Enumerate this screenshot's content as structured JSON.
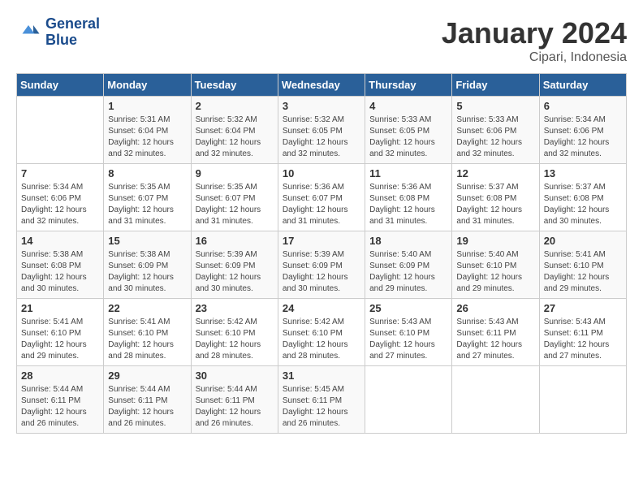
{
  "header": {
    "logo_line1": "General",
    "logo_line2": "Blue",
    "title": "January 2024",
    "subtitle": "Cipari, Indonesia"
  },
  "days_of_week": [
    "Sunday",
    "Monday",
    "Tuesday",
    "Wednesday",
    "Thursday",
    "Friday",
    "Saturday"
  ],
  "weeks": [
    [
      {
        "day": "",
        "sunrise": "",
        "sunset": "",
        "daylight": ""
      },
      {
        "day": "1",
        "sunrise": "Sunrise: 5:31 AM",
        "sunset": "Sunset: 6:04 PM",
        "daylight": "Daylight: 12 hours and 32 minutes."
      },
      {
        "day": "2",
        "sunrise": "Sunrise: 5:32 AM",
        "sunset": "Sunset: 6:04 PM",
        "daylight": "Daylight: 12 hours and 32 minutes."
      },
      {
        "day": "3",
        "sunrise": "Sunrise: 5:32 AM",
        "sunset": "Sunset: 6:05 PM",
        "daylight": "Daylight: 12 hours and 32 minutes."
      },
      {
        "day": "4",
        "sunrise": "Sunrise: 5:33 AM",
        "sunset": "Sunset: 6:05 PM",
        "daylight": "Daylight: 12 hours and 32 minutes."
      },
      {
        "day": "5",
        "sunrise": "Sunrise: 5:33 AM",
        "sunset": "Sunset: 6:06 PM",
        "daylight": "Daylight: 12 hours and 32 minutes."
      },
      {
        "day": "6",
        "sunrise": "Sunrise: 5:34 AM",
        "sunset": "Sunset: 6:06 PM",
        "daylight": "Daylight: 12 hours and 32 minutes."
      }
    ],
    [
      {
        "day": "7",
        "sunrise": "Sunrise: 5:34 AM",
        "sunset": "Sunset: 6:06 PM",
        "daylight": "Daylight: 12 hours and 32 minutes."
      },
      {
        "day": "8",
        "sunrise": "Sunrise: 5:35 AM",
        "sunset": "Sunset: 6:07 PM",
        "daylight": "Daylight: 12 hours and 31 minutes."
      },
      {
        "day": "9",
        "sunrise": "Sunrise: 5:35 AM",
        "sunset": "Sunset: 6:07 PM",
        "daylight": "Daylight: 12 hours and 31 minutes."
      },
      {
        "day": "10",
        "sunrise": "Sunrise: 5:36 AM",
        "sunset": "Sunset: 6:07 PM",
        "daylight": "Daylight: 12 hours and 31 minutes."
      },
      {
        "day": "11",
        "sunrise": "Sunrise: 5:36 AM",
        "sunset": "Sunset: 6:08 PM",
        "daylight": "Daylight: 12 hours and 31 minutes."
      },
      {
        "day": "12",
        "sunrise": "Sunrise: 5:37 AM",
        "sunset": "Sunset: 6:08 PM",
        "daylight": "Daylight: 12 hours and 31 minutes."
      },
      {
        "day": "13",
        "sunrise": "Sunrise: 5:37 AM",
        "sunset": "Sunset: 6:08 PM",
        "daylight": "Daylight: 12 hours and 30 minutes."
      }
    ],
    [
      {
        "day": "14",
        "sunrise": "Sunrise: 5:38 AM",
        "sunset": "Sunset: 6:08 PM",
        "daylight": "Daylight: 12 hours and 30 minutes."
      },
      {
        "day": "15",
        "sunrise": "Sunrise: 5:38 AM",
        "sunset": "Sunset: 6:09 PM",
        "daylight": "Daylight: 12 hours and 30 minutes."
      },
      {
        "day": "16",
        "sunrise": "Sunrise: 5:39 AM",
        "sunset": "Sunset: 6:09 PM",
        "daylight": "Daylight: 12 hours and 30 minutes."
      },
      {
        "day": "17",
        "sunrise": "Sunrise: 5:39 AM",
        "sunset": "Sunset: 6:09 PM",
        "daylight": "Daylight: 12 hours and 30 minutes."
      },
      {
        "day": "18",
        "sunrise": "Sunrise: 5:40 AM",
        "sunset": "Sunset: 6:09 PM",
        "daylight": "Daylight: 12 hours and 29 minutes."
      },
      {
        "day": "19",
        "sunrise": "Sunrise: 5:40 AM",
        "sunset": "Sunset: 6:10 PM",
        "daylight": "Daylight: 12 hours and 29 minutes."
      },
      {
        "day": "20",
        "sunrise": "Sunrise: 5:41 AM",
        "sunset": "Sunset: 6:10 PM",
        "daylight": "Daylight: 12 hours and 29 minutes."
      }
    ],
    [
      {
        "day": "21",
        "sunrise": "Sunrise: 5:41 AM",
        "sunset": "Sunset: 6:10 PM",
        "daylight": "Daylight: 12 hours and 29 minutes."
      },
      {
        "day": "22",
        "sunrise": "Sunrise: 5:41 AM",
        "sunset": "Sunset: 6:10 PM",
        "daylight": "Daylight: 12 hours and 28 minutes."
      },
      {
        "day": "23",
        "sunrise": "Sunrise: 5:42 AM",
        "sunset": "Sunset: 6:10 PM",
        "daylight": "Daylight: 12 hours and 28 minutes."
      },
      {
        "day": "24",
        "sunrise": "Sunrise: 5:42 AM",
        "sunset": "Sunset: 6:10 PM",
        "daylight": "Daylight: 12 hours and 28 minutes."
      },
      {
        "day": "25",
        "sunrise": "Sunrise: 5:43 AM",
        "sunset": "Sunset: 6:10 PM",
        "daylight": "Daylight: 12 hours and 27 minutes."
      },
      {
        "day": "26",
        "sunrise": "Sunrise: 5:43 AM",
        "sunset": "Sunset: 6:11 PM",
        "daylight": "Daylight: 12 hours and 27 minutes."
      },
      {
        "day": "27",
        "sunrise": "Sunrise: 5:43 AM",
        "sunset": "Sunset: 6:11 PM",
        "daylight": "Daylight: 12 hours and 27 minutes."
      }
    ],
    [
      {
        "day": "28",
        "sunrise": "Sunrise: 5:44 AM",
        "sunset": "Sunset: 6:11 PM",
        "daylight": "Daylight: 12 hours and 26 minutes."
      },
      {
        "day": "29",
        "sunrise": "Sunrise: 5:44 AM",
        "sunset": "Sunset: 6:11 PM",
        "daylight": "Daylight: 12 hours and 26 minutes."
      },
      {
        "day": "30",
        "sunrise": "Sunrise: 5:44 AM",
        "sunset": "Sunset: 6:11 PM",
        "daylight": "Daylight: 12 hours and 26 minutes."
      },
      {
        "day": "31",
        "sunrise": "Sunrise: 5:45 AM",
        "sunset": "Sunset: 6:11 PM",
        "daylight": "Daylight: 12 hours and 26 minutes."
      },
      {
        "day": "",
        "sunrise": "",
        "sunset": "",
        "daylight": ""
      },
      {
        "day": "",
        "sunrise": "",
        "sunset": "",
        "daylight": ""
      },
      {
        "day": "",
        "sunrise": "",
        "sunset": "",
        "daylight": ""
      }
    ]
  ]
}
